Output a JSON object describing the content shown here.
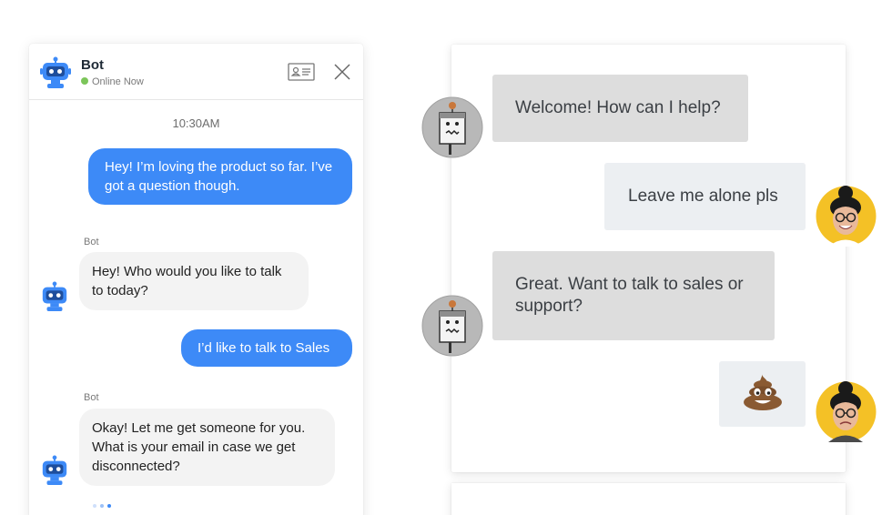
{
  "widget": {
    "header": {
      "name": "Bot",
      "status": "Online Now",
      "status_color": "#7cc55a",
      "card_icon": "contact-card-icon",
      "close_icon": "close-icon"
    },
    "timestamp": "10:30AM",
    "messages": [
      {
        "from": "user",
        "text": "Hey! I’m loving the product so far. I’ve got a question though."
      },
      {
        "from": "bot",
        "sender": "Bot",
        "text": "Hey! Who would you like to talk to today?"
      },
      {
        "from": "user",
        "text": "I’d like to talk to Sales"
      },
      {
        "from": "bot",
        "sender": "Bot",
        "text": "Okay! Let me get someone for you. What is your email in case we get disconnected?"
      }
    ],
    "accent_color": "#3d8af7"
  },
  "panel": {
    "messages": [
      {
        "from": "bot",
        "text": "Welcome! How can I help?",
        "avatar": "sad-robot-avatar"
      },
      {
        "from": "user",
        "text": "Leave me alone pls",
        "avatar": "user-avatar"
      },
      {
        "from": "bot",
        "text": "Great. Want to talk to sales or support?",
        "avatar": "sad-robot-avatar"
      },
      {
        "from": "user",
        "text": "💩",
        "avatar": "user-avatar"
      }
    ]
  }
}
